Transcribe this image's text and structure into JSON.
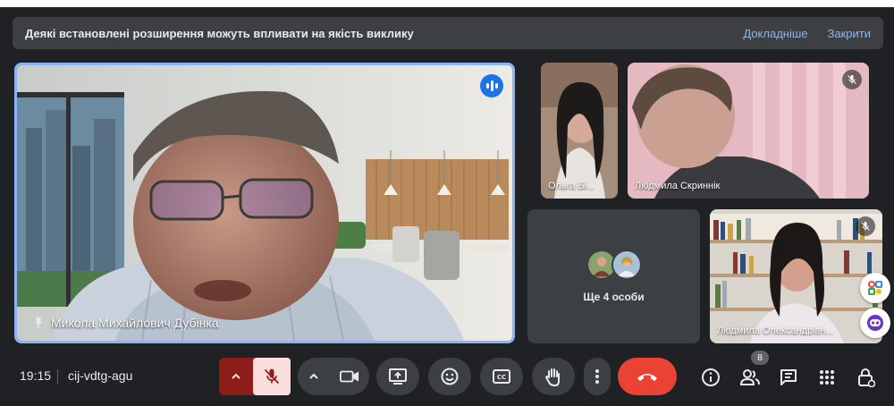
{
  "banner": {
    "message": "Деякі встановлені розширення можуть впливати на якість виклику",
    "details_link": "Докладніше",
    "close_link": "Закрити"
  },
  "participants": {
    "main": {
      "name": "Микола Михайлович Дубінка"
    },
    "olga": {
      "name": "Ольга Бі..."
    },
    "lyudmyla_s": {
      "name": "Людмила Скриннік"
    },
    "lyudmyla_o": {
      "name": "Людмила Олександрівн..."
    },
    "others": {
      "label": "Ще 4 особи"
    }
  },
  "footer": {
    "time": "19:15",
    "meeting_code": "cij-vdtg-agu",
    "participant_count": "8"
  },
  "icons": {
    "speaking": "audio-level-icon",
    "muted": "mic-off-icon",
    "pin": "pin-icon",
    "chevron": "chevron-up-icon",
    "camera": "videocam-icon",
    "present": "present-screen-icon",
    "emoji": "emoji-icon",
    "captions": "closed-captions-icon",
    "hand": "raise-hand-icon",
    "more": "more-vert-icon",
    "hangup": "call-end-icon",
    "info": "info-icon",
    "people": "people-icon",
    "chat": "chat-icon",
    "activities": "apps-grid-icon",
    "host": "host-controls-icon"
  },
  "colors": {
    "background": "#202124",
    "surface": "#3c4043",
    "accent": "#8ab4f8",
    "danger": "#ea4335",
    "mic_off_bg": "#8c1d18"
  }
}
